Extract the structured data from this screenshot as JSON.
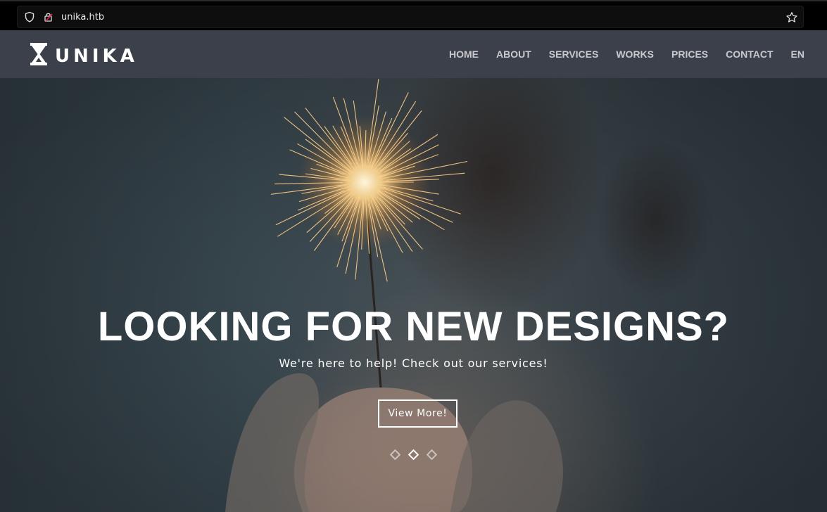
{
  "browser": {
    "url": "unika.htb"
  },
  "navbar": {
    "logo_text": "UNIKA",
    "items": [
      {
        "label": "HOME"
      },
      {
        "label": "ABOUT"
      },
      {
        "label": "SERVICES"
      },
      {
        "label": "WORKS"
      },
      {
        "label": "PRICES"
      },
      {
        "label": "CONTACT"
      },
      {
        "label": "EN"
      }
    ]
  },
  "hero": {
    "title": "LOOKING FOR NEW DESIGNS?",
    "subtitle": "We're here to help! Check out our services!",
    "button_label": "View More!",
    "slide_count": 3,
    "active_slide": 2
  },
  "icons": {
    "url_left": [
      "shield-icon",
      "lock-icon"
    ],
    "url_right": [
      "star-icon"
    ],
    "logo": "hourglass-logo-icon"
  }
}
